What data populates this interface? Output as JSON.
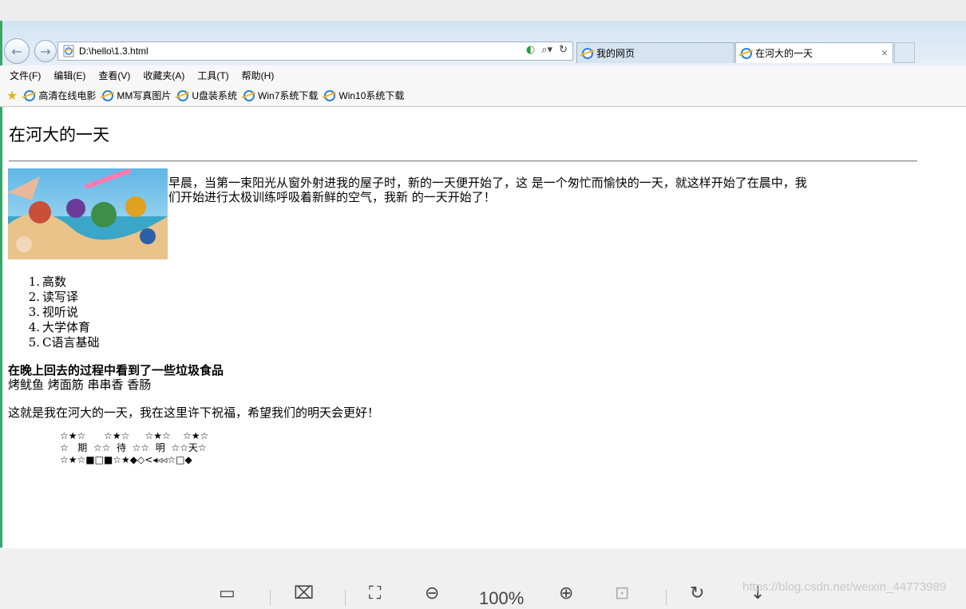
{
  "browser": {
    "address_url": "D:\\hello\\1.3.html",
    "tabs": [
      {
        "label": "我的网页"
      },
      {
        "label": "在河大的一天"
      }
    ],
    "menu": [
      "文件(F)",
      "编辑(E)",
      "查看(V)",
      "收藏夹(A)",
      "工具(T)",
      "帮助(H)"
    ],
    "favorites": [
      "高清在线电影",
      "MM写真图片",
      "U盘装系统",
      "Win7系统下载",
      "Win10系统下载"
    ]
  },
  "page": {
    "title": "在河大的一天",
    "intro": "早晨，当第一束阳光从窗外射进我的屋子时，新的一天便开始了，这 是一个匆忙而愉快的一天，就这样开始了在晨中，我们开始进行太极训练呼吸着新鲜的空气，我新 的一天开始了！",
    "courses": [
      "高数",
      "读写译",
      "视听说",
      "大学体育",
      "C语言基础"
    ],
    "evening_heading": "在晚上回去的过程中看到了一些垃圾食品",
    "foods": "烤鱿鱼 烤面筋 串串香 香肠",
    "wish": "这就是我在河大的一天，我在这里许下祝福，希望我们的明天会更好！",
    "star_lines": [
      "☆★☆      ☆★☆     ☆★☆    ☆★☆",
      "☆   期  ☆☆  待  ☆☆  明  ☆☆天☆",
      "☆★☆■□■☆★◆◇<◂◃◃☆□◆"
    ]
  },
  "viewer": {
    "zoom": "100%",
    "watermark": "https://blog.csdn.net/weixin_44773989"
  }
}
